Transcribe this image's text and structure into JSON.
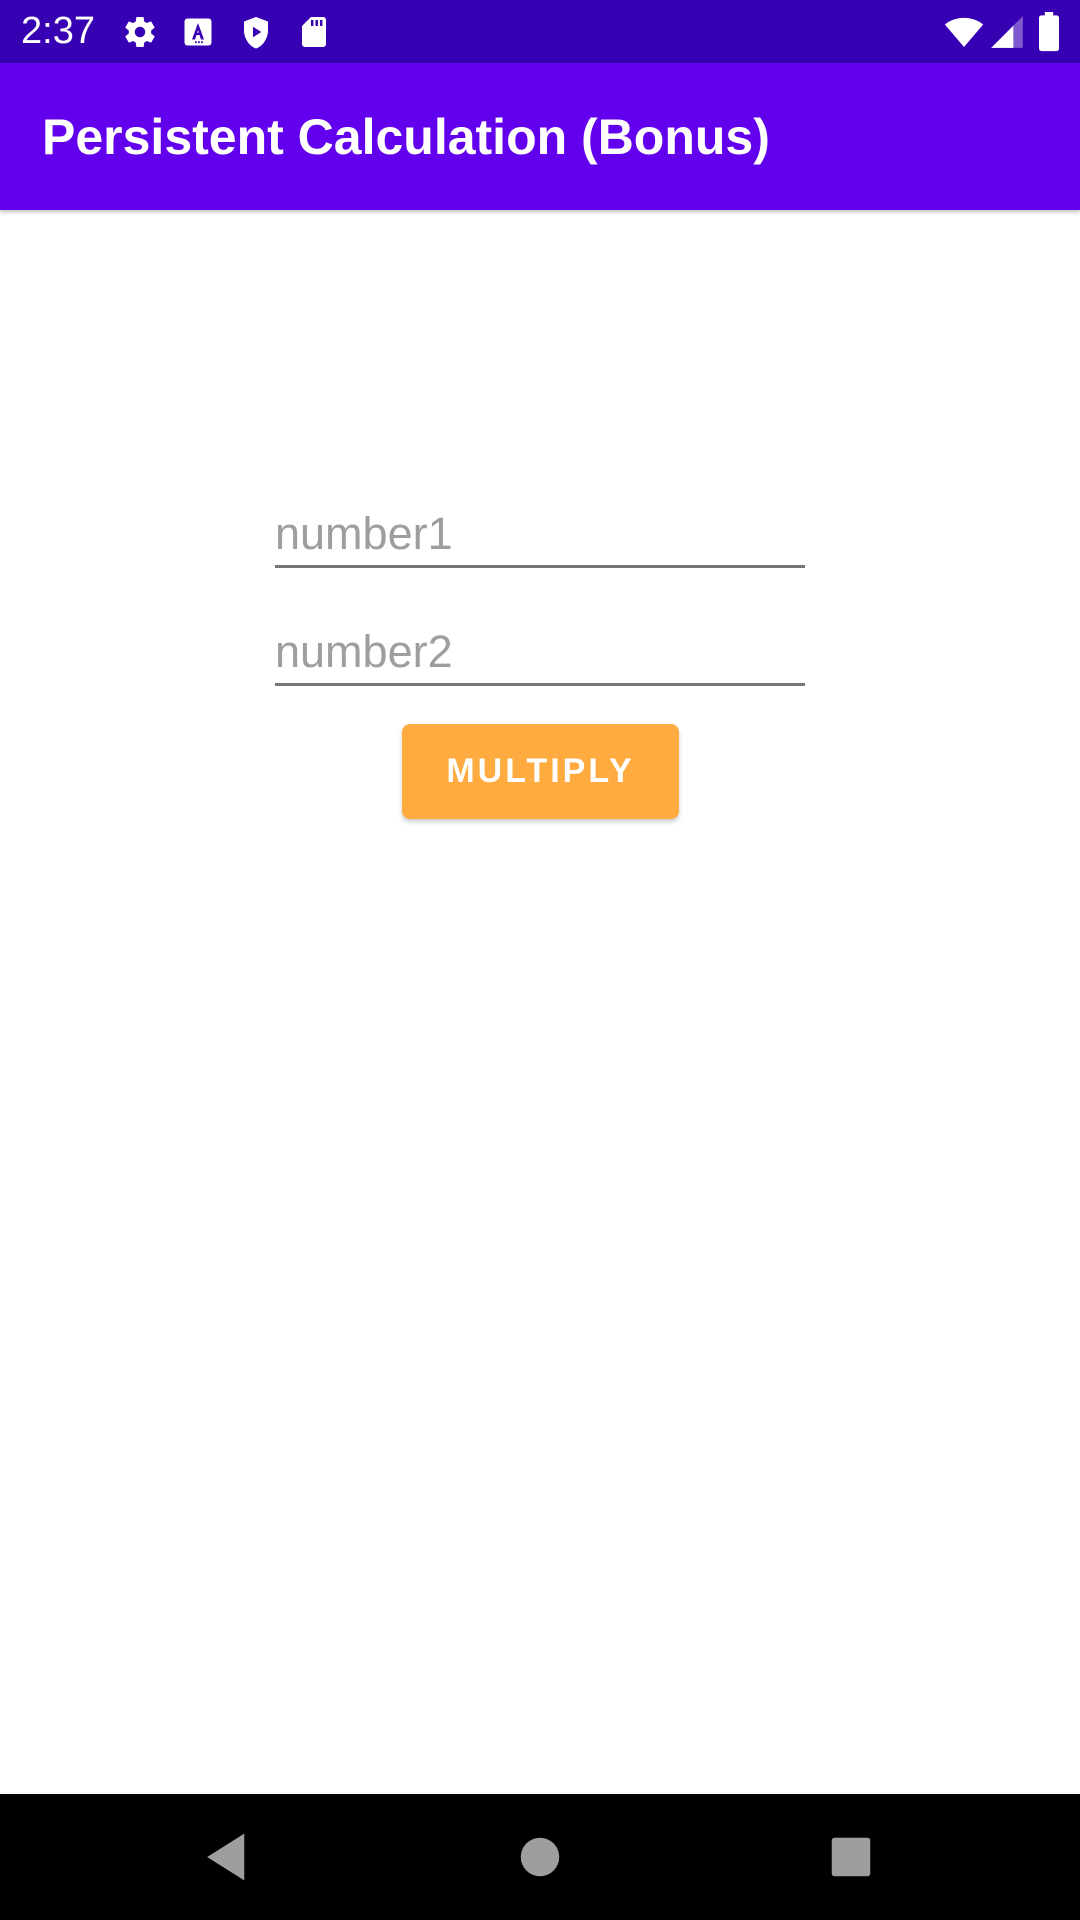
{
  "status_bar": {
    "time": "2:37",
    "icons": [
      "settings-icon",
      "a-notification-icon",
      "shield-play-icon",
      "sd-card-icon",
      "wifi-icon",
      "signal-icon",
      "battery-icon"
    ],
    "background": "#3700b3"
  },
  "app_bar": {
    "title": "Persistent Calculation (Bonus)",
    "background": "#6200ee"
  },
  "form": {
    "number1": {
      "value": "",
      "placeholder": "number1"
    },
    "number2": {
      "value": "",
      "placeholder": "number2"
    },
    "multiply_label": "MULTIPLY",
    "button_color": "#ffab40"
  },
  "nav_bar": {
    "icons": [
      "back-icon",
      "home-icon",
      "recents-icon"
    ]
  }
}
